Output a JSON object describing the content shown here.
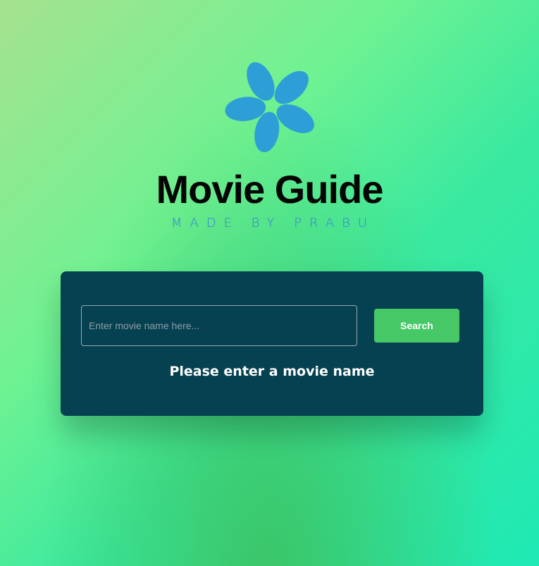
{
  "header": {
    "title": "Movie Guide",
    "subtitle": "MADE BY PRABU",
    "logo_icon": "pinwheel-icon",
    "logo_color": "#2d9fd6"
  },
  "search": {
    "placeholder": "Enter movie name here...",
    "value": "",
    "button_label": "Search"
  },
  "result": {
    "message": "Please enter a movie name"
  },
  "colors": {
    "card_background": "#064151",
    "button_background": "#46c867",
    "title_color": "#050505",
    "subtitle_color": "#3a7ee0"
  }
}
